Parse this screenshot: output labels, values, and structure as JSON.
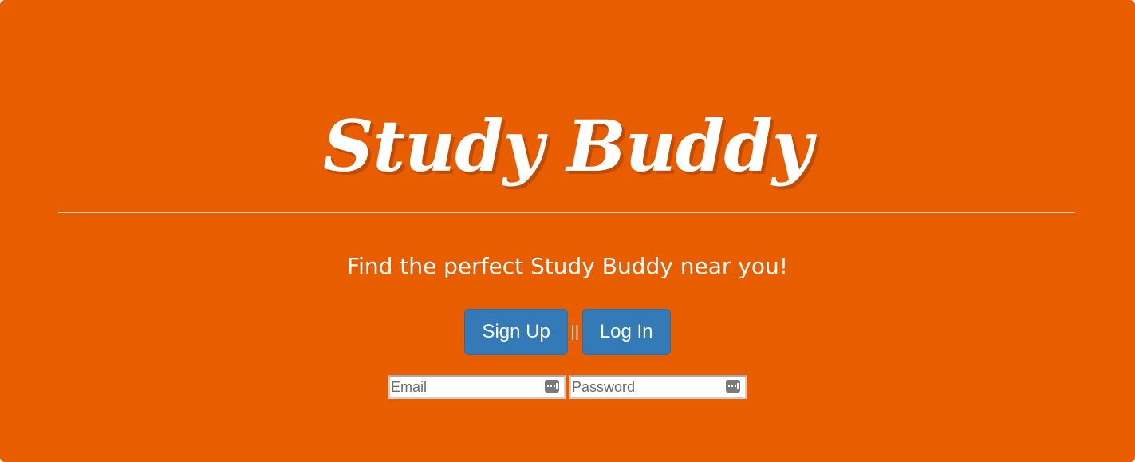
{
  "colors": {
    "background": "#e85d00",
    "button": "#337ab7",
    "button_border": "#2e6da4",
    "text": "#ffffff"
  },
  "hero": {
    "title": "Study Buddy",
    "tagline": "Find the perfect Study Buddy near you!"
  },
  "actions": {
    "signup_label": "Sign Up",
    "separator": "||",
    "login_label": "Log In"
  },
  "form": {
    "email": {
      "placeholder": "Email",
      "value": "",
      "icon": "password-manager-key-icon"
    },
    "password": {
      "placeholder": "Password",
      "value": "",
      "icon": "password-manager-key-icon"
    }
  }
}
